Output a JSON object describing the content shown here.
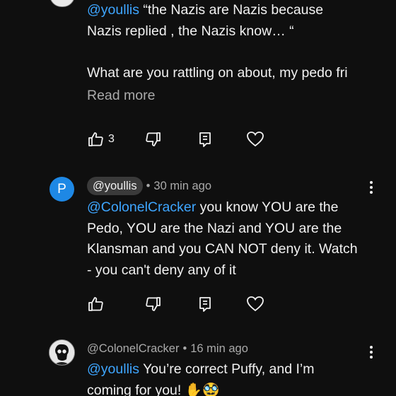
{
  "comment_top": {
    "mention": "@youllis",
    "line1_rest": "“the Nazis are Nazis because",
    "line2": "Nazis replied , the Nazis know… “",
    "line3": "What are you rattling on about, my pedo fri",
    "read_more": "Read more",
    "likes": "3"
  },
  "comment_reply1": {
    "avatar_letter": "P",
    "author": "@youllis",
    "time": "30 min ago",
    "mention": "@ColonelCracker",
    "line1_rest": "you know YOU are the",
    "line2": "Pedo, YOU are the Nazi and YOU are the",
    "line3": "Klansman and you CAN NOT deny it. Watch",
    "line4": "- you can't deny any of it"
  },
  "comment_reply2": {
    "author": "@ColonelCracker",
    "time": "16 min ago",
    "mention": "@youllis",
    "line1_rest": "You’re correct Puffy, and I’m",
    "line2": "coming for you! ✋🥸"
  },
  "ui": {
    "separator": "•",
    "icons": [
      "like-icon",
      "dislike-icon",
      "reply-icon",
      "heart-icon",
      "more-vert-icon"
    ]
  }
}
